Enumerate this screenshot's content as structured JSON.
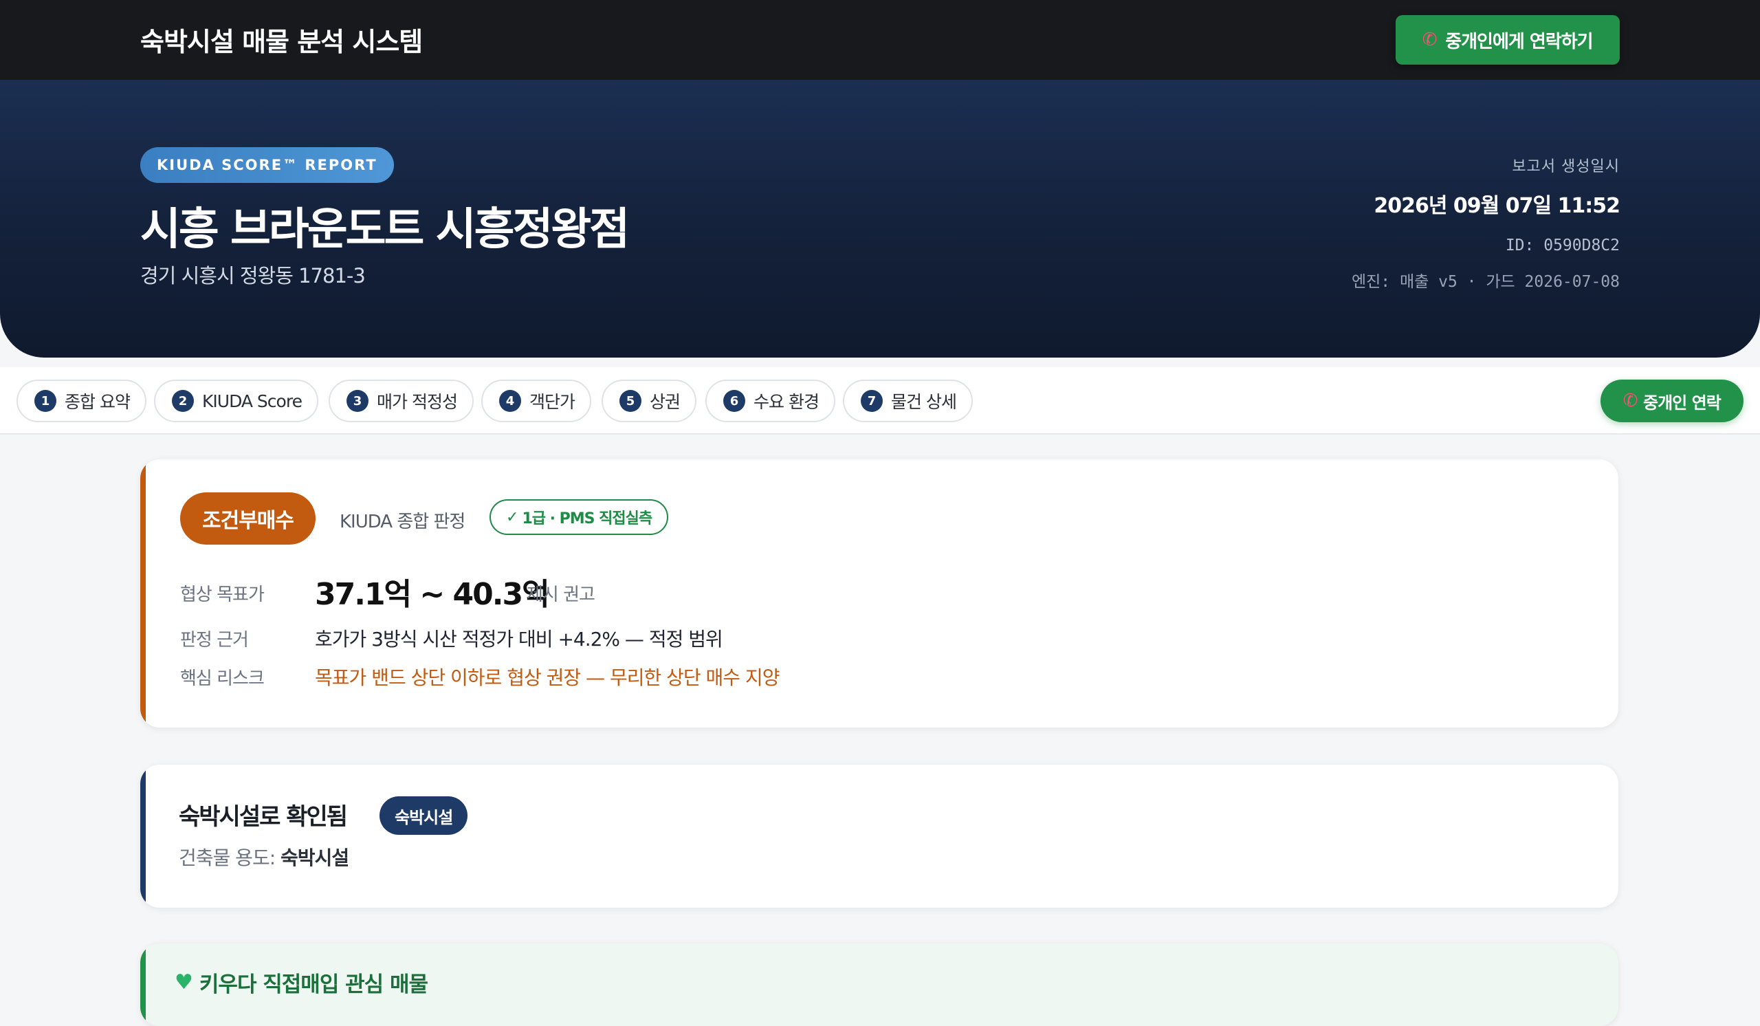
{
  "topbar": {
    "title": "숙박시설 매물 분석 시스템",
    "contact_label": "중개인에게 연락하기"
  },
  "hero": {
    "pill": "KIUDA SCORE™ REPORT",
    "property_name": "시흥 브라운도트 시흥정왕점",
    "address": "경기 시흥시 정왕동 1781-3",
    "meta_label": "보고서 생성일시",
    "meta_date": "2026년 09월 07일 11:52",
    "meta_id": "ID: 0590D8C2",
    "meta_engine": "엔진: 매출 v5 · 가드 2026-07-08"
  },
  "tabs": [
    {
      "num": "1",
      "label": "종합 요약"
    },
    {
      "num": "2",
      "label": "KIUDA Score"
    },
    {
      "num": "3",
      "label": "매가 적정성"
    },
    {
      "num": "4",
      "label": "객단가"
    },
    {
      "num": "5",
      "label": "상권"
    },
    {
      "num": "6",
      "label": "수요 환경"
    },
    {
      "num": "7",
      "label": "물건 상세"
    }
  ],
  "tab_contact_label": "중개인 연락",
  "verdict": {
    "badge": "조건부매수",
    "label": "KIUDA 종합 판정",
    "grade": "1급 · PMS 직접실측",
    "target_label": "협상 목표가",
    "target_value": "37.1억 ~ 40.3억",
    "target_note": "제시 권고",
    "basis_label": "판정 근거",
    "basis_value": "호가가 3방식 시산 적정가 대비 +4.2% — 적정 범위",
    "risk_label": "핵심 리스크",
    "risk_value": "목표가 밴드 상단 이하로 협상 권장 — 무리한 상단 매수 지양"
  },
  "lodging": {
    "title": "숙박시설로 확인됨",
    "badge": "숙박시설",
    "sub_label": "건축물 용도: ",
    "sub_value": "숙박시설"
  },
  "interest": {
    "title": "키우다 직접매입 관심 매물"
  },
  "colors": {
    "accent_orange": "#c25a10",
    "accent_green": "#22924a",
    "accent_navy": "#1e3a66"
  },
  "icons": {
    "phone": "phone-icon",
    "check": "check-icon",
    "heart": "heart-icon"
  }
}
